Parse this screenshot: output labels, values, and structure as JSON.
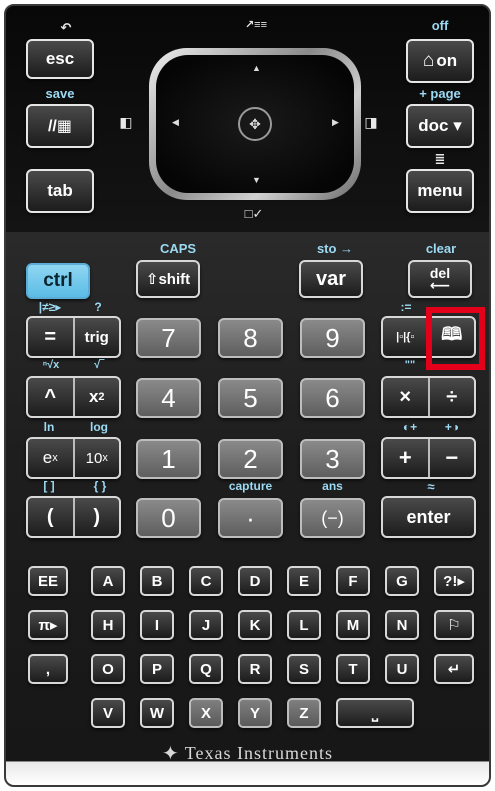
{
  "top": {
    "undo_label": "↶",
    "esc": "esc",
    "save_label": "save",
    "scratchpad_icon": "//▦",
    "tab": "tab",
    "off_label": "off",
    "on": "on",
    "home_icon": "⌂",
    "page_label": "+ page",
    "doc": "doc ▾",
    "menu_context_icon": "≣",
    "menu": "menu",
    "touchpad_top_label": "↗≡≡",
    "touchpad_bottom_label": "□✓",
    "left_side_icon": "◧",
    "right_side_icon": "◨"
  },
  "labels": {
    "caps": "CAPS",
    "sto": "sto →",
    "clear": "clear",
    "neq": "|≠≥▸",
    "help": "?",
    "assign": ":=",
    "nthroot": "ⁿ√x",
    "sqrt": "√‾",
    "quote": "\"\"",
    "ln": "ln",
    "log": "log",
    "capture": "capture",
    "ans": "ans",
    "approx": "≈",
    "brackets": "[ ]",
    "braces": "{ }"
  },
  "keys": {
    "ctrl": "ctrl",
    "shift": "⇧shift",
    "var": "var",
    "del": "del",
    "eq": "=",
    "trig": "trig",
    "templates_icon": "|▫|{▫",
    "catalog_icon": "🕮",
    "caret": "^",
    "x2": "x",
    "x2_sup": "2",
    "ex": "e",
    "ex_sup": "x",
    "tenx": "10",
    "tenx_sup": "x",
    "lparen": "(",
    "rparen": ")",
    "mul": "×",
    "div": "÷",
    "add": "+",
    "sub": "−",
    "neg": "(−)",
    "dot": "·",
    "enter": "enter",
    "n7": "7",
    "n8": "8",
    "n9": "9",
    "n4": "4",
    "n5": "5",
    "n6": "6",
    "n1": "1",
    "n2": "2",
    "n3": "3",
    "n0": "0"
  },
  "alpha_rows": [
    [
      "EE",
      "A",
      "B",
      "C",
      "D",
      "E",
      "F",
      "G",
      "?!▸"
    ],
    [
      "π▸",
      "H",
      "I",
      "J",
      "K",
      "L",
      "M",
      "N",
      "⚐"
    ],
    [
      ",",
      "O",
      "P",
      "Q",
      "R",
      "S",
      "T",
      "U",
      "↵"
    ],
    [
      "V",
      "W",
      "X",
      "Y",
      "Z",
      "⎵"
    ]
  ],
  "brand": "Texas Instruments",
  "brand_glyph": "✦",
  "colors": {
    "accent_blue": "#9cd9f3",
    "ctrl_blue": "#5cbce6",
    "highlight_red": "#e4001a"
  }
}
